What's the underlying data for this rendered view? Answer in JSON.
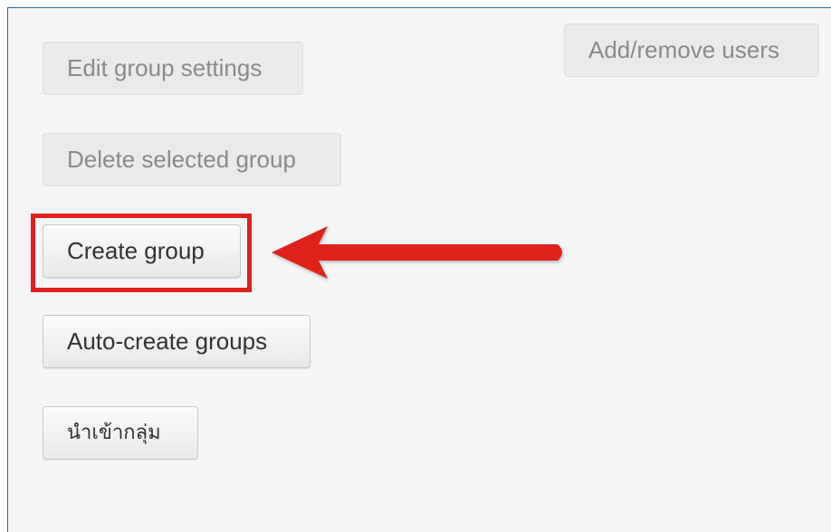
{
  "buttons": {
    "edit_group_settings": "Edit group settings",
    "add_remove_users": "Add/remove users",
    "delete_selected_group": "Delete selected group",
    "create_group": "Create group",
    "auto_create_groups": "Auto-create groups",
    "import_groups": "นำเข้ากลุ่ม"
  },
  "annotation": {
    "highlight_color": "#e0201b",
    "arrow_color": "#e0201b",
    "panel_border_color": "#1f6aa8"
  }
}
